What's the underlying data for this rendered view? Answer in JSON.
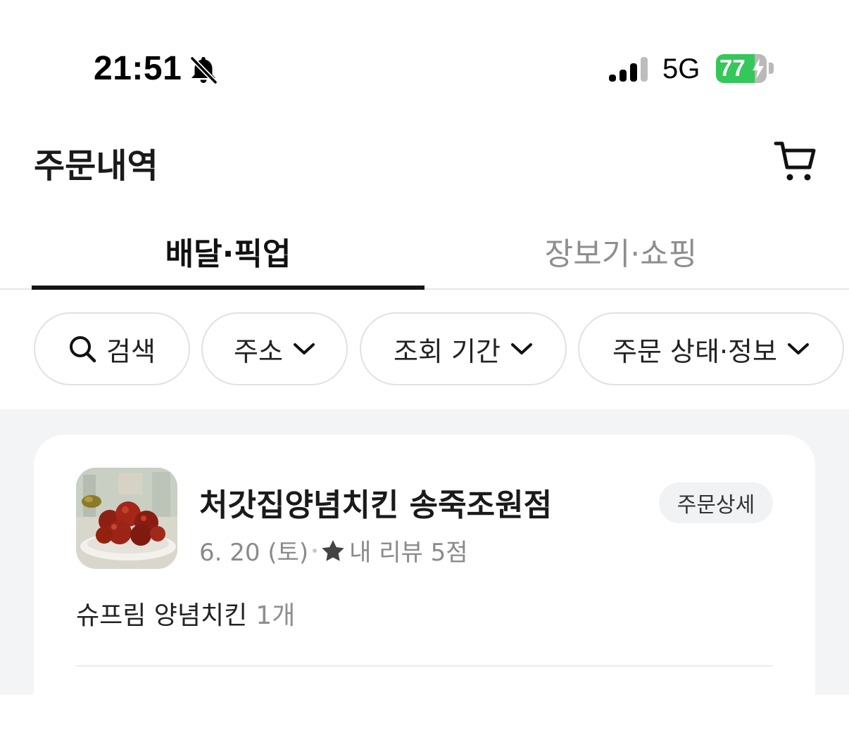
{
  "status_bar": {
    "time": "21:51",
    "network": "5G",
    "battery_percent": "77",
    "signal_bars_active": 3,
    "signal_bars_total": 4,
    "silent_icon": "bell-slash-icon",
    "charging_icon": "bolt-icon"
  },
  "header": {
    "title": "주문내역",
    "cart_icon": "cart-icon"
  },
  "tabs": [
    {
      "label": "배달·픽업",
      "selected": true
    },
    {
      "label": "장보기·쇼핑",
      "selected": false
    }
  ],
  "filters": {
    "search_label": "검색",
    "address_label": "주소",
    "period_label": "조회 기간",
    "status_label": "주문 상태·정보"
  },
  "orders": [
    {
      "store_name": "처갓집양념치킨 송죽조원점",
      "date": "6. 20 (토)",
      "review": "내 리뷰 5점",
      "detail_button": "주문상세",
      "item_name": "슈프림 양념치킨",
      "item_qty": "1개"
    }
  ],
  "colors": {
    "accent_text": "#111111",
    "inactive_tab": "#8e8e8e",
    "battery_green": "#34c759",
    "list_background": "#f3f4f6"
  }
}
